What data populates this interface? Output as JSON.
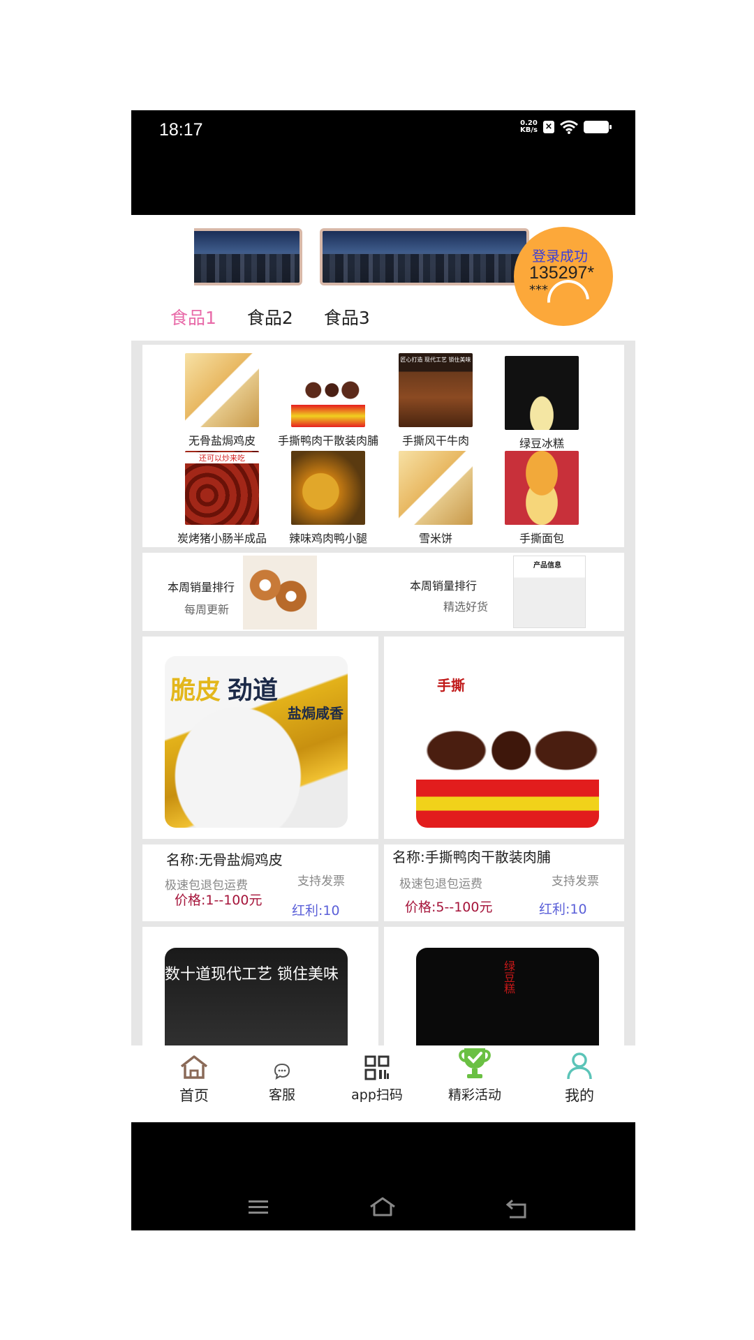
{
  "status_bar": {
    "time": "18:17",
    "net_speed_value": "0.20",
    "net_speed_unit": "KB/s"
  },
  "login_toast": {
    "title": "登录成功",
    "user": "135297*",
    "mask": "***"
  },
  "tabs": [
    {
      "label": "食品1",
      "active": true
    },
    {
      "label": "食品2",
      "active": false
    },
    {
      "label": "食品3",
      "active": false
    }
  ],
  "categories": [
    {
      "label": "无骨盐焗鸡皮",
      "icon": "crackers"
    },
    {
      "label": "手撕鸭肉干散装肉脯",
      "icon": "duck"
    },
    {
      "label": "手撕风干牛肉",
      "icon": "beef"
    },
    {
      "label": "绿豆冰糕",
      "icon": "greenbean"
    },
    {
      "label": "炭烤猪小肠半成品",
      "icon": "sausage"
    },
    {
      "label": "辣味鸡肉鸭小腿",
      "icon": "chicken"
    },
    {
      "label": "雪米饼",
      "icon": "crackers"
    },
    {
      "label": "手撕面包",
      "icon": "bread"
    }
  ],
  "category_overlays": {
    "beef_caption": "匠心打造 现代工艺 锁住美味",
    "sausage_caption": "还可以炒来吃",
    "crackers_caption": "雪米饼"
  },
  "rank": {
    "left": {
      "title": "本周销量排行",
      "sub": "每周更新"
    },
    "right": {
      "title": "本周销量排行",
      "sub": "精选好货",
      "img_caption": "产品信息"
    }
  },
  "products": [
    {
      "name": "名称:无骨盐焗鸡皮",
      "shipping": "极速包退包运费",
      "invoice": "支持发票",
      "price": "价格:1--100元",
      "bonus": "红利:10",
      "img_text_1": "脆皮",
      "img_text_2": "劲道",
      "img_text_3": "盐焗咸香"
    },
    {
      "name": "名称:手撕鸭肉干散装肉脯",
      "shipping": "极速包退包运费",
      "invoice": "支持发票",
      "price": "价格:5--100元",
      "bonus": "红利:10",
      "img_text_1": "手撕"
    }
  ],
  "more_products": [
    {
      "caption": "数十道现代工艺 锁住美味"
    },
    {
      "caption": "绿豆糕"
    }
  ],
  "bottom_nav": [
    {
      "label": "首页",
      "icon": "home-icon"
    },
    {
      "label": "客服",
      "icon": "chat-icon"
    },
    {
      "label": "app扫码",
      "icon": "qr-scan-icon"
    },
    {
      "label": "精彩活动",
      "icon": "trophy-icon"
    },
    {
      "label": "我的",
      "icon": "profile-icon"
    }
  ],
  "colors": {
    "tab_active": "#e86aa8",
    "toast_bg": "#fca83a",
    "toast_title": "#3b3fd8",
    "price": "#a5143a",
    "bonus": "#5a5fd8",
    "content_bg": "#e6e6e6"
  }
}
